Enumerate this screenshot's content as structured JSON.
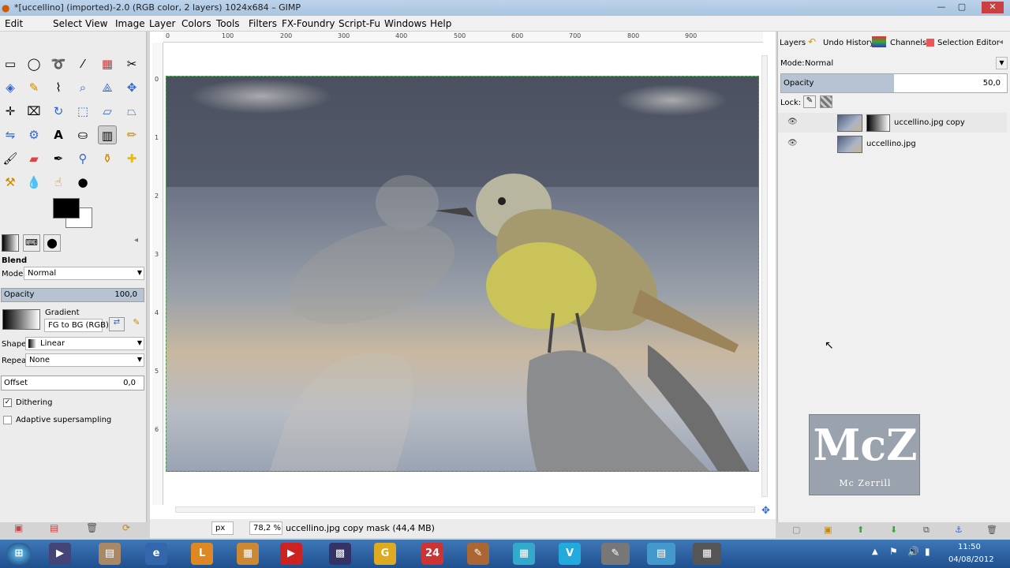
{
  "window": {
    "title": "*[uccellino] (imported)-2.0 (RGB color, 2 layers) 1024x684 – GIMP"
  },
  "menu": [
    "Edit",
    "Select",
    "View",
    "Image",
    "Layer",
    "Colors",
    "Tools",
    "Filters",
    "FX-Foundry",
    "Script-Fu",
    "Windows",
    "Help"
  ],
  "toolbox": {
    "section_title": "Blend",
    "mode_label": "Mode:",
    "mode_value": "Normal",
    "opacity_label": "Opacity",
    "opacity_value": "100,0",
    "gradient_label": "Gradient",
    "gradient_value": "FG to BG (RGB)",
    "shape_label": "Shape:",
    "shape_value": "Linear",
    "repeat_label": "Repeat:",
    "repeat_value": "None",
    "offset_label": "Offset",
    "offset_value": "0,0",
    "dithering_label": "Dithering",
    "dithering_checked": true,
    "adaptive_label": "Adaptive supersampling",
    "adaptive_checked": false
  },
  "rulers": {
    "top_ticks": [
      "0",
      "100",
      "200",
      "300",
      "400",
      "500",
      "600",
      "700",
      "800",
      "900"
    ],
    "left_ticks": [
      "0",
      "1",
      "2",
      "3",
      "4",
      "5",
      "6"
    ]
  },
  "dock": {
    "tabs": [
      "Layers",
      "Undo History",
      "Channels",
      "Selection Editor"
    ],
    "mode_label": "Mode:",
    "mode_value": "Normal",
    "opacity_label": "Opacity",
    "opacity_value": "50,0",
    "opacity_fraction": 0.5,
    "lock_label": "Lock:",
    "layers": [
      {
        "name": "uccellino.jpg copy",
        "has_mask": true
      },
      {
        "name": "uccellino.jpg",
        "has_mask": false
      }
    ]
  },
  "watermark": {
    "text": "McZ",
    "subtitle": "Mc Zerrill"
  },
  "statusbar": {
    "unit": "px",
    "zoom": "78,2 %",
    "message": "uccellino.jpg copy mask (44,4 MB)"
  },
  "taskbar": {
    "time": "11:50",
    "date": "04/08/2012"
  },
  "colors": {
    "fg": "#000000",
    "bg": "#ffffff",
    "accent": "#3fa03f",
    "dock_opacity_fill": "#b5c3d3"
  }
}
